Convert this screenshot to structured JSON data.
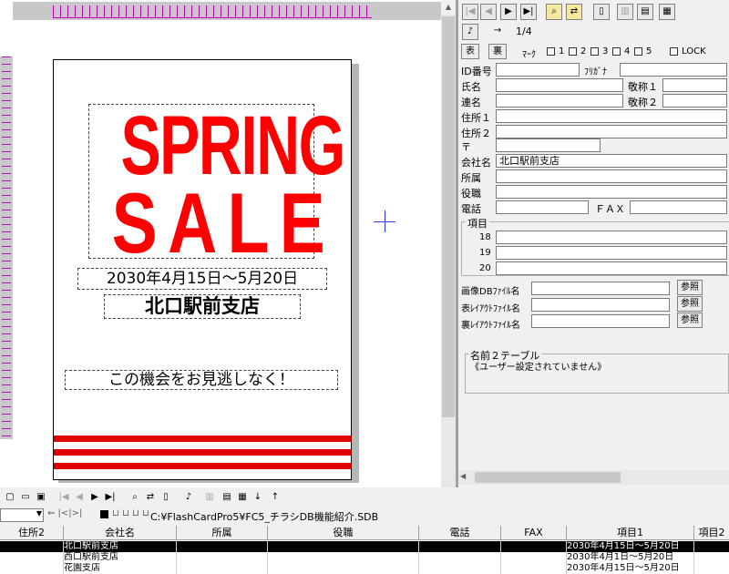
{
  "poster": {
    "headline_1": "SPRING",
    "headline_2": "SALE",
    "date_range": "2030年4月15日～5月20日",
    "branch": "北口駅前支店",
    "message": "この機会をお見逃しなく！"
  },
  "nav": {
    "first": "|◀",
    "prev": "◀",
    "next": "▶",
    "last": "▶|",
    "bell_icon": "🔔",
    "jump": "→",
    "record_position": "1/4"
  },
  "side_toggle": {
    "front": "表",
    "back": "裏"
  },
  "marks": {
    "label": "ﾏｰｸ",
    "items": [
      "1",
      "2",
      "3",
      "4",
      "5"
    ],
    "lock": "LOCK"
  },
  "form": {
    "id_label": "ID番号",
    "id_value": "",
    "furigana_label": "ﾌﾘｶﾞﾅ",
    "furigana_value": "",
    "name_label": "氏名",
    "name_value": "",
    "title1_label": "敬称１",
    "title1_value": "",
    "joint_label": "連名",
    "joint_value": "",
    "title2_label": "敬称２",
    "title2_value": "",
    "address1_label": "住所１",
    "address1_value": "",
    "address2_label": "住所２",
    "address2_value": "",
    "zip_label": "〒",
    "zip_value": "",
    "company_label": "会社名",
    "company_value": "北口駅前支店",
    "dept_label": "所属",
    "dept_value": "",
    "position_label": "役職",
    "position_value": "",
    "phone_label": "電話",
    "phone_value": "",
    "fax_label": "ＦＡＸ",
    "fax_value": ""
  },
  "items": {
    "group_title": "項目",
    "rows": [
      {
        "num": "18",
        "value": ""
      },
      {
        "num": "19",
        "value": ""
      },
      {
        "num": "20",
        "value": ""
      }
    ]
  },
  "files": {
    "image_db_label": "画像DBﾌｧｲﾙ名",
    "front_layout_label": "表ﾚｲｱｳﾄﾌｧｲﾙ名",
    "back_layout_label": "裏ﾚｲｱｳﾄﾌｧｲﾙ名",
    "browse": "参照"
  },
  "name2": {
    "group_title": "名前２テーブル",
    "content": "《ユーザー設定されていません》"
  },
  "bottom": {
    "path": "C:¥FlashCardPro5¥FC5_チラシDB機能紹介.SDB",
    "columns": [
      "住所2",
      "会社名",
      "所属",
      "役職",
      "電話",
      "FAX",
      "項目1",
      "項目2"
    ],
    "rows": [
      {
        "company": "北口駅前支店",
        "item1": "2030年4月15日～5月20日",
        "selected": true
      },
      {
        "company": "西口駅前支店",
        "item1": "2030年4月1日～5月20日",
        "selected": false
      },
      {
        "company": "花園支店",
        "item1": "2030年4月15日～5月20日",
        "selected": false
      }
    ]
  }
}
